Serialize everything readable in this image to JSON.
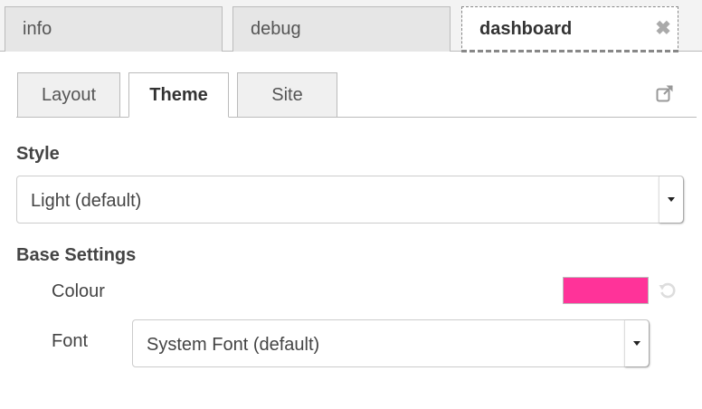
{
  "top_tabs": [
    {
      "label": "info"
    },
    {
      "label": "debug"
    },
    {
      "label": "dashboard"
    }
  ],
  "inner_tabs": [
    {
      "label": "Layout"
    },
    {
      "label": "Theme"
    },
    {
      "label": "Site"
    }
  ],
  "active_inner_tab": "Theme",
  "close_icon": {
    "glyph": "✖"
  },
  "style": {
    "label": "Style",
    "selected": "Light (default)"
  },
  "base_settings": {
    "label": "Base Settings",
    "colour": {
      "label": "Colour",
      "value": "#ff3399"
    },
    "font": {
      "label": "Font",
      "selected": "System Font (default)"
    }
  },
  "icons": {
    "close": "close-icon",
    "popout": "external-link-icon",
    "reset": "reset-icon",
    "caret": "chevron-down-icon"
  }
}
